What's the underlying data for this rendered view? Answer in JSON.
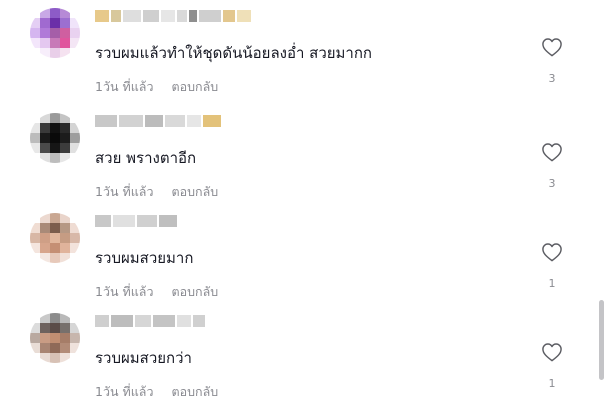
{
  "comments": [
    {
      "text": "รวบผมแล้วทำให้ชุดดันน้อยลงอ่ำ สวยมากก",
      "time": "1วัน ที่แล้ว",
      "reply_label": "ตอบกลับ",
      "likes": "3",
      "avatar_colors": [
        "#ffffff",
        "#c9a9e6",
        "#8d5bc7",
        "#b68ad6",
        "#ffffff",
        "#e4cff4",
        "#a06ad0",
        "#6b2fa8",
        "#9c6fd0",
        "#f0e4fa",
        "#d5b6f0",
        "#b07ad8",
        "#a55ea8",
        "#cf5fa0",
        "#e9d2f0",
        "#f3e6fb",
        "#e4c8f0",
        "#c77ab8",
        "#e0559d",
        "#f4e6f5",
        "#ffffff",
        "#f7eefb",
        "#e9cfe9",
        "#f5e2f0",
        "#ffffff"
      ],
      "username_colors": [
        "#e7c98a",
        "#d8c89c",
        "#dedede",
        "#cfcfcf",
        "#e6e6e6",
        "#d9d9d9",
        "#8f8f8f",
        "#cfcfcf",
        "#e3c78e",
        "#efe0b8"
      ]
    },
    {
      "text": "สวย พรางตาอีก",
      "time": "1วัน ที่แล้ว",
      "reply_label": "ตอบกลับ",
      "likes": "3",
      "avatar_colors": [
        "#ffffff",
        "#d9d9d9",
        "#9a9a9a",
        "#c4c4c4",
        "#ffffff",
        "#e6e6e6",
        "#3a3a3a",
        "#121212",
        "#2a2a2a",
        "#d4d4d4",
        "#bcbcbc",
        "#1a1a1a",
        "#0a0a0a",
        "#1c1c1c",
        "#9e9e9e",
        "#e8e8e8",
        "#4a4a4a",
        "#161616",
        "#3c3c3c",
        "#e0e0e0",
        "#ffffff",
        "#e0e0e0",
        "#bdbdbd",
        "#e6e6e6",
        "#ffffff"
      ],
      "username_colors": [
        "#c8c8c8",
        "#d2d2d2",
        "#bcbcbc",
        "#d9d9d9",
        "#e6e6e6",
        "#e3c27a"
      ]
    },
    {
      "text": "รวบผมสวยมาก",
      "time": "1วัน ที่แล้ว",
      "reply_label": "ตอบกลับ",
      "likes": "1",
      "avatar_colors": [
        "#ffffff",
        "#ecd9d0",
        "#c9a792",
        "#e9d4ca",
        "#ffffff",
        "#f0ddd3",
        "#a98a78",
        "#7c5d4c",
        "#b69884",
        "#efdcd3",
        "#d8b7a5",
        "#cf9f86",
        "#e2b79d",
        "#c69c83",
        "#d8b8a8",
        "#f4e5de",
        "#d7a58c",
        "#c58f74",
        "#e0b39b",
        "#f3e3dc",
        "#ffffff",
        "#f4e7e1",
        "#e7c9ba",
        "#f1e0d8",
        "#ffffff"
      ],
      "username_colors": [
        "#c8c8c8",
        "#e0e0e0",
        "#d0d0d0",
        "#bfbfbf"
      ]
    },
    {
      "text": "รวบผมสวยกว่า",
      "time": "1วัน ที่แล้ว",
      "reply_label": "ตอบกลับ",
      "likes": "1",
      "avatar_colors": [
        "#ffffff",
        "#c9c9c9",
        "#8c8c8c",
        "#b9b9b9",
        "#ffffff",
        "#dcdcdc",
        "#6e625e",
        "#5a4c48",
        "#77706c",
        "#d6d6d6",
        "#b9a9a0",
        "#c99c84",
        "#c08e72",
        "#a67d68",
        "#c7b6ad",
        "#e9ddd6",
        "#a98573",
        "#8f6a58",
        "#b28b77",
        "#efe2dc",
        "#ffffff",
        "#e9dbd4",
        "#d7c1b5",
        "#eee0d9",
        "#ffffff"
      ],
      "username_colors": [
        "#cfcfcf",
        "#bdbdbd",
        "#d6d6d6",
        "#c4c4c4",
        "#e0e0e0",
        "#d0d0d0"
      ]
    }
  ]
}
